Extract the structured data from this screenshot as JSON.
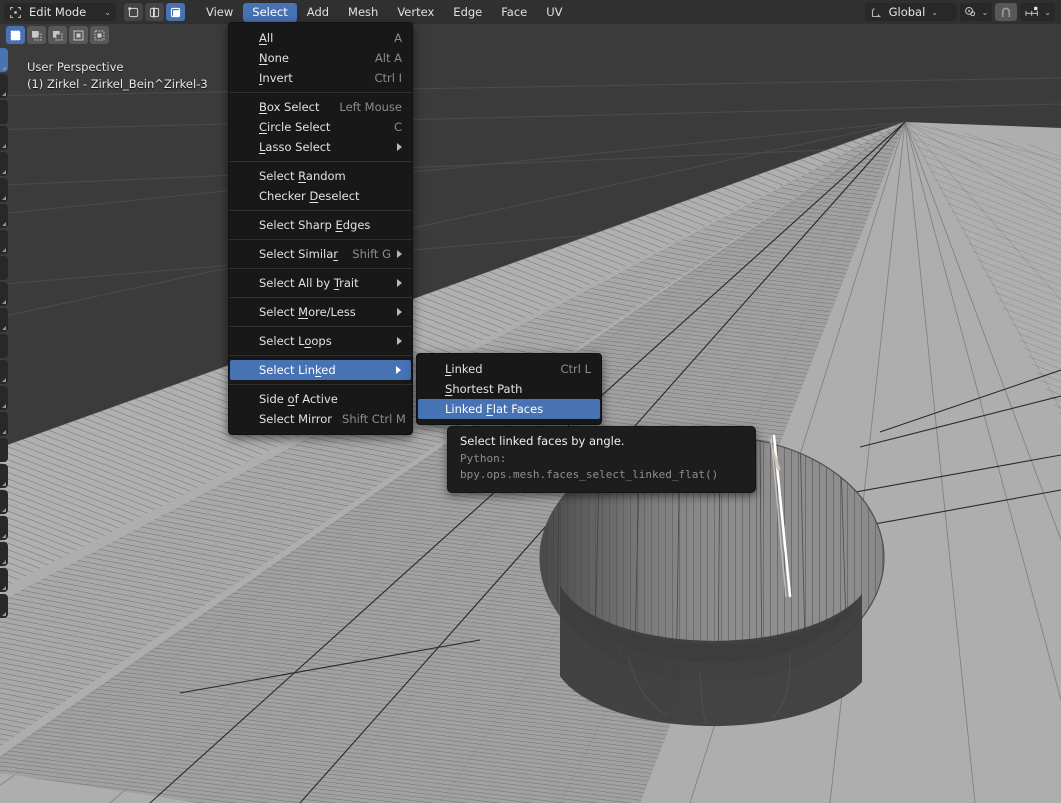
{
  "header": {
    "mode": {
      "label": "Edit Mode",
      "icon": "edit-mode-icon",
      "chevron": "⌄"
    },
    "mesh_select_modes": [
      {
        "name": "vertex-select-mode",
        "label": "Vertex",
        "active": false
      },
      {
        "name": "edge-select-mode",
        "label": "Edge",
        "active": false
      },
      {
        "name": "face-select-mode",
        "label": "Face",
        "active": true
      }
    ],
    "menus": [
      {
        "label": "View",
        "open": false
      },
      {
        "label": "Select",
        "open": true
      },
      {
        "label": "Add",
        "open": false
      },
      {
        "label": "Mesh",
        "open": false
      },
      {
        "label": "Vertex",
        "open": false
      },
      {
        "label": "Edge",
        "open": false
      },
      {
        "label": "Face",
        "open": false
      },
      {
        "label": "UV",
        "open": false
      }
    ],
    "transform_orientation": {
      "label": "Global",
      "icon": "orientation-axis-icon",
      "chevron": "⌄"
    },
    "pivot": {
      "icon": "pivot-point-icon",
      "chevron": "⌄"
    },
    "snap_magnet": {
      "icon": "snap-magnet-icon",
      "pressed": true
    },
    "snap_target": {
      "icon": "snap-increment-icon",
      "chevron": "⌄"
    }
  },
  "select_tool_modes": [
    {
      "name": "tweak-select-set",
      "active": true
    },
    {
      "name": "select-extend",
      "active": false
    },
    {
      "name": "select-subtract",
      "active": false
    },
    {
      "name": "select-invert",
      "active": false
    },
    {
      "name": "select-intersect",
      "active": false
    }
  ],
  "toolbar": [
    {
      "name": "tweak-tool",
      "active": true
    },
    {
      "name": "select-box-tool",
      "active": false
    },
    {
      "name": "cursor-tool",
      "active": false
    },
    {
      "name": "move-tool",
      "active": false
    },
    {
      "name": "rotate-tool",
      "active": false
    },
    {
      "name": "scale-tool",
      "active": false
    },
    {
      "name": "transform-tool",
      "active": false
    },
    {
      "name": "annotate-tool",
      "active": false
    },
    {
      "name": "measure-tool",
      "active": false
    },
    {
      "name": "add-cube-tool",
      "active": false
    },
    {
      "name": "extrude-region-tool",
      "active": false
    },
    {
      "name": "inset-faces-tool",
      "active": false
    },
    {
      "name": "bevel-tool",
      "active": false
    },
    {
      "name": "loop-cut-tool",
      "active": false
    },
    {
      "name": "knife-tool",
      "active": false
    },
    {
      "name": "poly-build-tool",
      "active": false
    },
    {
      "name": "spin-tool",
      "active": false
    },
    {
      "name": "smooth-tool",
      "active": false
    },
    {
      "name": "edge-slide-tool",
      "active": false
    },
    {
      "name": "shrink-fatten-tool",
      "active": false
    },
    {
      "name": "shear-tool",
      "active": false
    },
    {
      "name": "rip-region-tool",
      "active": false
    }
  ],
  "viewport": {
    "perspective_label": "User Perspective",
    "object_label": "(1) Zirkel - Zirkel_Bein^Zirkel-3"
  },
  "select_menu": {
    "groups": [
      [
        {
          "label": "All",
          "accel": "A",
          "shortcut": "A",
          "submenu": false
        },
        {
          "label": "None",
          "accel": "N",
          "shortcut": "Alt A",
          "submenu": false
        },
        {
          "label": "Invert",
          "accel": "I",
          "shortcut": "Ctrl I",
          "submenu": false
        }
      ],
      [
        {
          "label": "Box Select",
          "accel": "B",
          "shortcut": "Left Mouse",
          "submenu": false
        },
        {
          "label": "Circle Select",
          "accel": "C",
          "shortcut": "C",
          "submenu": false
        },
        {
          "label": "Lasso Select",
          "accel": "L",
          "shortcut": "",
          "submenu": true
        }
      ],
      [
        {
          "label": "Select Random",
          "accel": "R",
          "shortcut": "",
          "submenu": false
        },
        {
          "label": "Checker Deselect",
          "accel": "D",
          "shortcut": "",
          "submenu": false
        }
      ],
      [
        {
          "label": "Select Sharp Edges",
          "accel": "E",
          "shortcut": "",
          "submenu": false
        }
      ],
      [
        {
          "label": "Select Similar",
          "accel": "r",
          "shortcut": "Shift G",
          "submenu": true
        }
      ],
      [
        {
          "label": "Select All by Trait",
          "accel": "T",
          "shortcut": "",
          "submenu": true
        }
      ],
      [
        {
          "label": "Select More/Less",
          "accel": "M",
          "shortcut": "",
          "submenu": true
        }
      ],
      [
        {
          "label": "Select Loops",
          "accel": "o",
          "shortcut": "",
          "submenu": true
        }
      ],
      [
        {
          "label": "Select Linked",
          "accel": "k",
          "shortcut": "",
          "submenu": true,
          "highlighted": true
        }
      ],
      [
        {
          "label": "Side of Active",
          "accel": "o",
          "shortcut": "",
          "submenu": false
        },
        {
          "label": "Select Mirror",
          "accel": "",
          "shortcut": "Shift Ctrl M",
          "submenu": false
        }
      ]
    ]
  },
  "linked_submenu": {
    "items": [
      {
        "label": "Linked",
        "accel": "L",
        "shortcut": "Ctrl L",
        "highlighted": false
      },
      {
        "label": "Shortest Path",
        "accel": "S",
        "shortcut": "",
        "highlighted": false
      },
      {
        "label": "Linked Flat Faces",
        "accel": "F",
        "shortcut": "",
        "highlighted": true
      }
    ]
  },
  "tooltip": {
    "description": "Select linked faces by angle.",
    "python_label": "Python:",
    "python_path": "bpy.ops.mesh.faces_select_linked_flat()"
  },
  "colors": {
    "accent_blue": "#4772b3",
    "header_bg": "#303030",
    "menu_bg": "#181818",
    "viewport_grid_bg": "#3b3b3b",
    "mesh_surface": "#adadad",
    "selected_edge": "#ffffff"
  }
}
